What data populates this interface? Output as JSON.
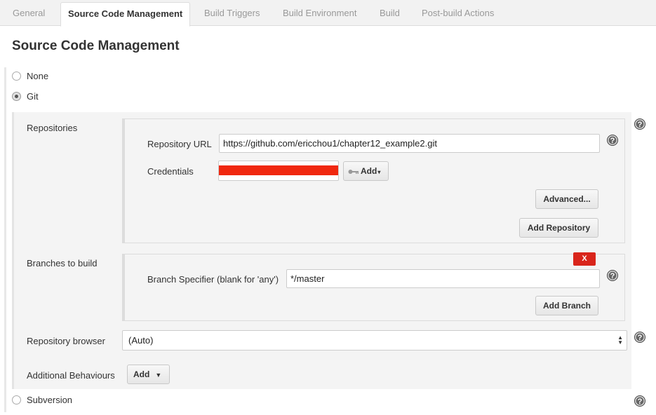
{
  "tabs": [
    {
      "label": "General"
    },
    {
      "label": "Source Code Management"
    },
    {
      "label": "Build Triggers"
    },
    {
      "label": "Build Environment"
    },
    {
      "label": "Build"
    },
    {
      "label": "Post-build Actions"
    }
  ],
  "title": "Source Code Management",
  "scm_options": {
    "none": "None",
    "git": "Git",
    "subversion": "Subversion"
  },
  "selected_scm": "Git",
  "repositories": {
    "label": "Repositories",
    "url_label": "Repository URL",
    "url_value": "https://github.com/ericchou1/chapter12_example2.git",
    "credentials_label": "Credentials",
    "credentials_add": "Add",
    "advanced_button": "Advanced...",
    "add_repository_button": "Add Repository"
  },
  "branches": {
    "label": "Branches to build",
    "specifier_label": "Branch Specifier (blank for 'any')",
    "specifier_value": "*/master",
    "delete_label": "X",
    "add_branch_button": "Add Branch"
  },
  "repository_browser": {
    "label": "Repository browser",
    "selected": "(Auto)"
  },
  "additional_behaviours": {
    "label": "Additional Behaviours",
    "add_button": "Add"
  },
  "help_glyph": "?",
  "colors": {
    "redaction": "#f0280f",
    "delete_button": "#d9251b"
  }
}
